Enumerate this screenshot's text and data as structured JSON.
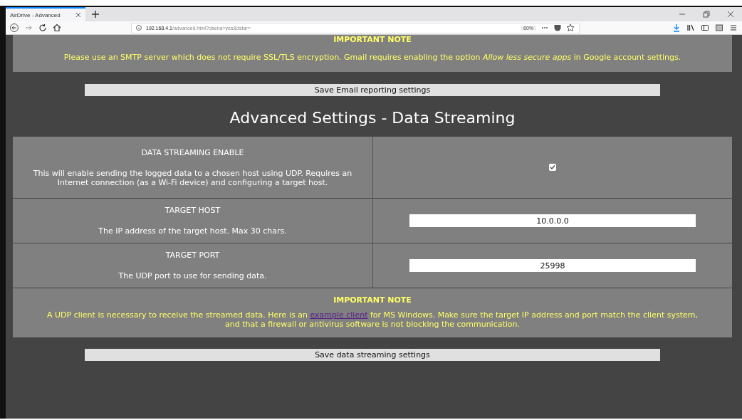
{
  "browser": {
    "tab_title": "AirDrive - Advanced",
    "url_host": "192.168.4.1",
    "url_path": "/advanced.html?dsena=yes&dstar=",
    "zoom": "60%"
  },
  "email_note": {
    "title": "IMPORTANT NOTE",
    "text": "Please use an SMTP server which does not require SSL/TLS encryption. Gmail requires enabling the option *Allow less secure apps* in Google account settings."
  },
  "email_save_button": "Save Email reporting settings",
  "heading": "Advanced Settings - Data Streaming",
  "settings": [
    {
      "kind": "checkbox",
      "label": "DATA STREAMING ENABLE",
      "description": "This will enable sending the logged data to a chosen host using UDP. Requires an Internet connection (as a Wi-Fi device) and configuring a target host.",
      "checked": true
    },
    {
      "kind": "text",
      "label": "TARGET HOST",
      "description": "The IP address of the target host. Max 30 chars.",
      "value": "10.0.0.0"
    },
    {
      "kind": "text",
      "label": "TARGET PORT",
      "description": "The UDP port to use for sending data.",
      "value": "25998"
    }
  ],
  "stream_note": {
    "title": "IMPORTANT NOTE",
    "text_before": "A UDP client is necessary to receive the streamed data. Here is an",
    "link": "example client",
    "text_after": "for MS Windows. Make sure the target IP address and port match the client system, and that a firewall or antivirus software is not blocking the communication."
  },
  "stream_save_button": "Save data streaming settings"
}
